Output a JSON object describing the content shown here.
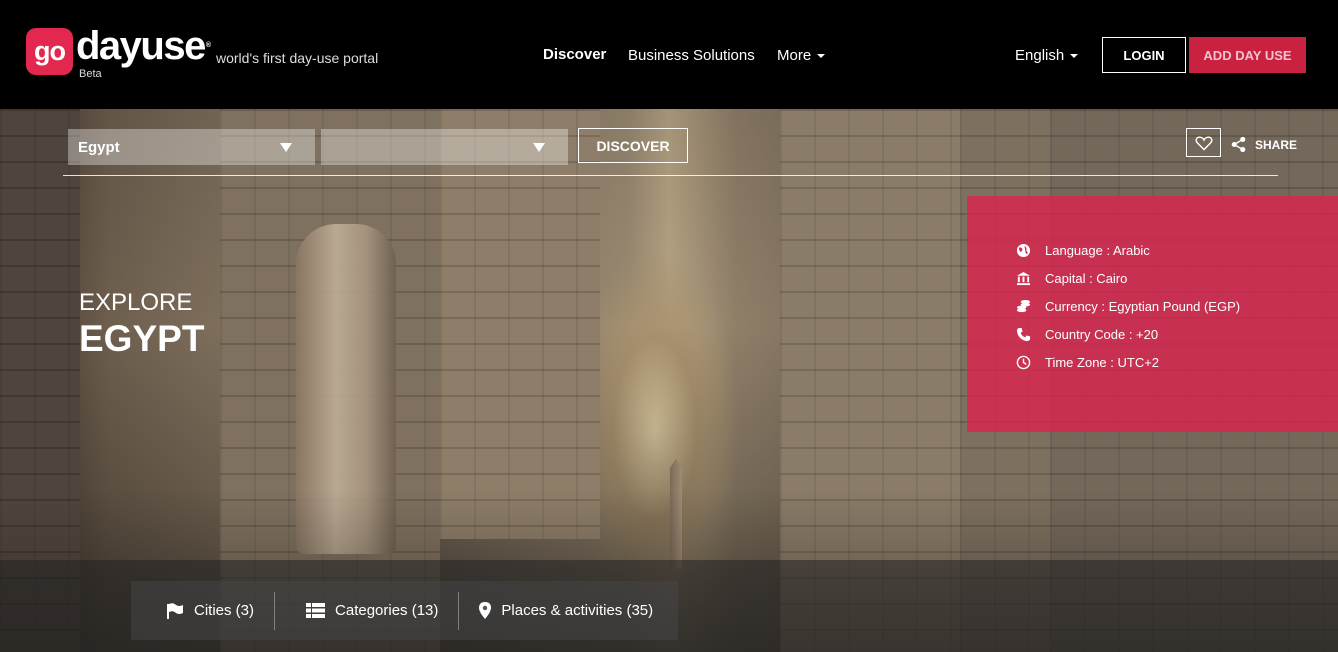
{
  "header": {
    "logo_mark": "go",
    "logo_word": "dayuse",
    "logo_reg": "®",
    "logo_beta": "Beta",
    "tagline": "world's first day-use portal",
    "nav": {
      "discover": "Discover",
      "business": "Business Solutions",
      "more": "More"
    },
    "language": "English",
    "login": "LOGIN",
    "add_day_use": "ADD DAY USE",
    "brand_color": "#e3284f"
  },
  "search": {
    "country_value": "Egypt",
    "city_value": "",
    "discover_label": "DISCOVER",
    "share_label": "SHARE"
  },
  "hero": {
    "explore_label": "EXPLORE",
    "country_name": "EGYPT"
  },
  "info": {
    "panel_color": "#d6274f",
    "rows": [
      {
        "icon": "globe-icon",
        "text": "Language : Arabic"
      },
      {
        "icon": "bank-icon",
        "text": "Capital : Cairo"
      },
      {
        "icon": "coins-icon",
        "text": "Currency : Egyptian Pound (EGP)"
      },
      {
        "icon": "phone-icon",
        "text": "Country Code : +20"
      },
      {
        "icon": "clock-icon",
        "text": "Time Zone : UTC+2"
      }
    ]
  },
  "tabs": {
    "cities": "Cities (3)",
    "categories": "Categories (13)",
    "places": "Places & activities (35)"
  }
}
